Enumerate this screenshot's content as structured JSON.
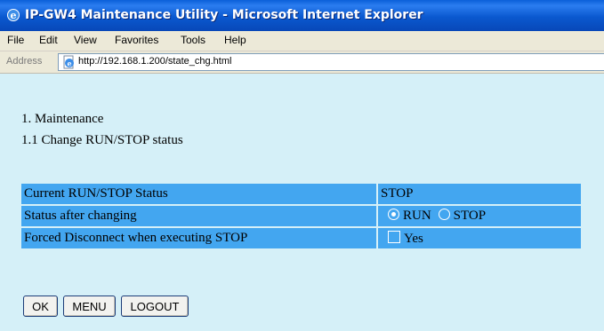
{
  "window": {
    "title": "IP-GW4 Maintenance Utility - Microsoft Internet Explorer",
    "icon": "ie-icon"
  },
  "menubar": {
    "items": [
      "File",
      "Edit",
      "View",
      "Favorites",
      "Tools",
      "Help"
    ]
  },
  "address": {
    "label": "Address",
    "url": "http://192.168.1.200/state_chg.html"
  },
  "page": {
    "heading1": "1. Maintenance",
    "heading2": "1.1 Change RUN/STOP status",
    "rows": [
      {
        "label": "Current RUN/STOP Status",
        "value": "STOP"
      },
      {
        "label": "Status after changing",
        "options": [
          "RUN",
          "STOP"
        ],
        "selected": "RUN"
      },
      {
        "label": "Forced Disconnect when executing STOP",
        "checkbox_label": "Yes",
        "checked": false
      }
    ],
    "buttons": [
      "OK",
      "MENU",
      "LOGOUT"
    ]
  },
  "colors": {
    "table_cell": "#43a6f0",
    "page_background": "#d5f0f8",
    "titlebar": "#0a58cf"
  }
}
